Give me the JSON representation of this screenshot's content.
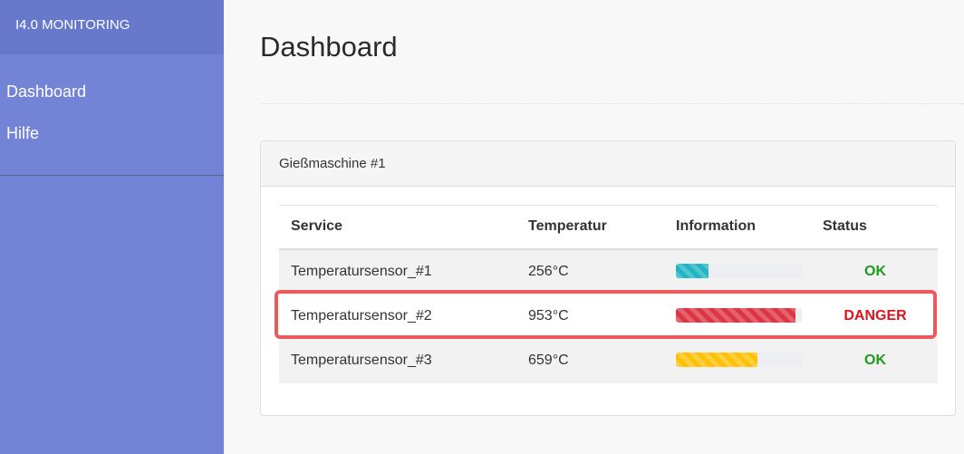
{
  "sidebar": {
    "brand": "I4.0 MONITORING",
    "items": [
      {
        "label": "Dashboard"
      },
      {
        "label": "Hilfe"
      }
    ]
  },
  "main": {
    "title": "Dashboard",
    "panel": {
      "heading": "Gießmaschine #1",
      "columns": [
        "Service",
        "Temperatur",
        "Information",
        "Status"
      ],
      "rows": [
        {
          "service": "Temperatursensor_#1",
          "temperature": "256°C",
          "progress_pct": 26,
          "bar_color": "#1fb5c2",
          "status": "OK",
          "status_color": "#1e9a1e"
        },
        {
          "service": "Temperatursensor_#2",
          "temperature": "953°C",
          "progress_pct": 95,
          "bar_color": "#dc3545",
          "status": "DANGER",
          "status_color": "#e3121f"
        },
        {
          "service": "Temperatursensor_#3",
          "temperature": "659°C",
          "progress_pct": 65,
          "bar_color": "#ffc107",
          "status": "OK",
          "status_color": "#1e9a1e"
        }
      ]
    }
  }
}
